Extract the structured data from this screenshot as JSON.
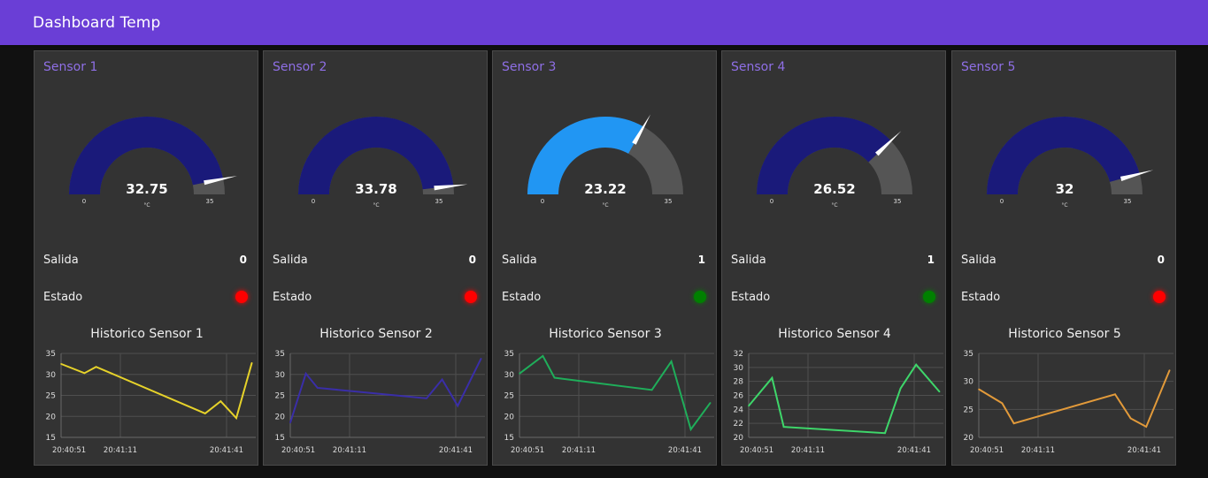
{
  "header": {
    "title": "Dashboard Temp"
  },
  "labels": {
    "salida": "Salida",
    "estado": "Estado"
  },
  "colors": {
    "header": "#6a3ed6",
    "card_title": "#8f6fe6",
    "gauge_bg": "#555555",
    "led_red": "#ff0000",
    "led_green": "#008000"
  },
  "sensors": [
    {
      "name": "Sensor 1",
      "gauge": {
        "value": 32.75,
        "display": "32.75",
        "unit": "°C",
        "min": 0,
        "max": 35,
        "min_label": "0",
        "max_label": "35",
        "color": "#1a1a7a"
      },
      "salida": "0",
      "estado": "red",
      "chart_title": "Historico Sensor 1"
    },
    {
      "name": "Sensor 2",
      "gauge": {
        "value": 33.78,
        "display": "33.78",
        "unit": "°C",
        "min": 0,
        "max": 35,
        "min_label": "0",
        "max_label": "35",
        "color": "#1a1a7a"
      },
      "salida": "0",
      "estado": "red",
      "chart_title": "Historico Sensor 2"
    },
    {
      "name": "Sensor 3",
      "gauge": {
        "value": 23.22,
        "display": "23.22",
        "unit": "°C",
        "min": 0,
        "max": 35,
        "min_label": "0",
        "max_label": "35",
        "color": "#2196f3"
      },
      "salida": "1",
      "estado": "green",
      "chart_title": "Historico Sensor 3"
    },
    {
      "name": "Sensor 4",
      "gauge": {
        "value": 26.52,
        "display": "26.52",
        "unit": "°C",
        "min": 0,
        "max": 35,
        "min_label": "0",
        "max_label": "35",
        "color": "#1a1a7a"
      },
      "salida": "1",
      "estado": "green",
      "chart_title": "Historico Sensor 4"
    },
    {
      "name": "Sensor 5",
      "gauge": {
        "value": 32,
        "display": "32",
        "unit": "°C",
        "min": 0,
        "max": 35,
        "min_label": "0",
        "max_label": "35",
        "color": "#1a1a7a"
      },
      "salida": "0",
      "estado": "red",
      "chart_title": "Historico Sensor 5"
    }
  ],
  "chart_data": [
    {
      "type": "line",
      "title": "Historico Sensor 1",
      "color": "#e6d22a",
      "x_ticks": [
        "20:40:51",
        "20:41:11",
        "20:41:41"
      ],
      "y_ticks": [
        "15",
        "20",
        "25",
        "30",
        "35"
      ],
      "ylim": [
        15,
        35
      ],
      "xlim": [
        0,
        50
      ],
      "grid": true,
      "x": [
        0,
        6,
        9,
        37,
        41,
        45,
        49
      ],
      "y": [
        32.5,
        30.3,
        31.8,
        20.7,
        23.6,
        19.6,
        32.75
      ]
    },
    {
      "type": "line",
      "title": "Historico Sensor 2",
      "color": "#3a2ea8",
      "x_ticks": [
        "20:40:51",
        "20:41:11",
        "20:41:41"
      ],
      "y_ticks": [
        "15",
        "20",
        "25",
        "30",
        "35"
      ],
      "ylim": [
        15,
        35
      ],
      "xlim": [
        0,
        50
      ],
      "grid": true,
      "x": [
        0,
        4,
        7,
        35,
        39,
        43,
        49
      ],
      "y": [
        18.5,
        30.2,
        26.8,
        24.3,
        28.8,
        22.5,
        33.78
      ]
    },
    {
      "type": "line",
      "title": "Historico Sensor 3",
      "color": "#1fae5a",
      "x_ticks": [
        "20:40:51",
        "20:41:11",
        "20:41:41"
      ],
      "y_ticks": [
        "15",
        "20",
        "25",
        "30",
        "35"
      ],
      "ylim": [
        15,
        35
      ],
      "xlim": [
        0,
        50
      ],
      "grid": true,
      "x": [
        0,
        6,
        9,
        34,
        39,
        44,
        49
      ],
      "y": [
        30.2,
        34.4,
        29.2,
        26.3,
        33.1,
        16.9,
        23.22
      ]
    },
    {
      "type": "line",
      "title": "Historico Sensor 4",
      "color": "#3ed66a",
      "x_ticks": [
        "20:40:51",
        "20:41:11",
        "20:41:41"
      ],
      "y_ticks": [
        "20",
        "22",
        "24",
        "26",
        "28",
        "30",
        "32"
      ],
      "ylim": [
        20,
        32
      ],
      "xlim": [
        0,
        50
      ],
      "grid": true,
      "x": [
        0,
        6,
        9,
        35,
        39,
        43,
        49
      ],
      "y": [
        24.5,
        28.5,
        21.5,
        20.6,
        27.0,
        30.4,
        26.52
      ]
    },
    {
      "type": "line",
      "title": "Historico Sensor 5",
      "color": "#e29a3a",
      "x_ticks": [
        "20:40:51",
        "20:41:11",
        "20:41:41"
      ],
      "y_ticks": [
        "20",
        "25",
        "30",
        "35"
      ],
      "ylim": [
        20,
        35
      ],
      "xlim": [
        0,
        50
      ],
      "grid": true,
      "x": [
        0,
        6,
        9,
        35,
        39,
        43,
        49
      ],
      "y": [
        28.6,
        26.1,
        22.5,
        27.7,
        23.4,
        21.9,
        32.0
      ]
    }
  ]
}
